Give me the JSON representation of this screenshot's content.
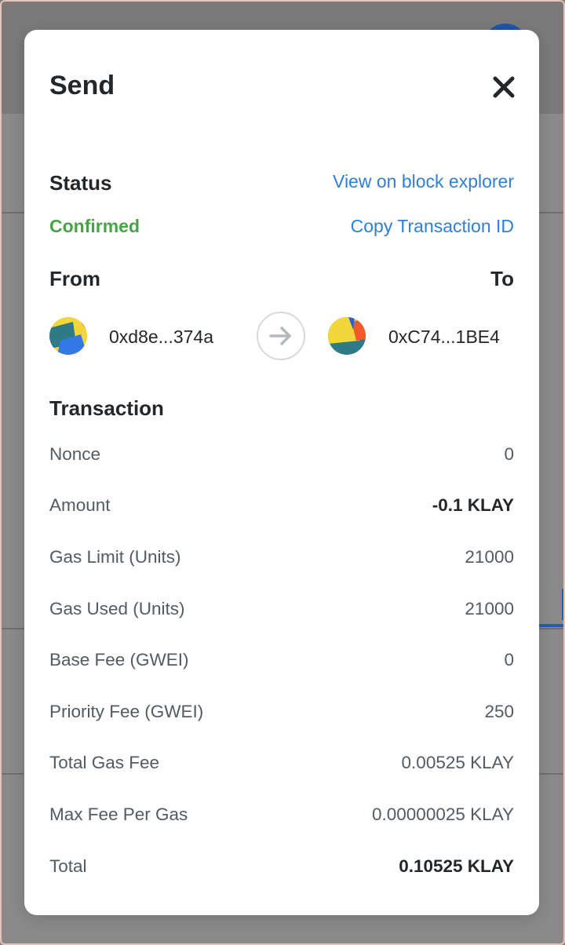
{
  "modal": {
    "title": "Send"
  },
  "status": {
    "label": "Status",
    "value": "Confirmed",
    "value_color": "#46a447",
    "view_explorer_link": "View on block explorer",
    "copy_tx_link": "Copy Transaction ID",
    "link_color": "#2f7fd6"
  },
  "parties": {
    "from_label": "From",
    "to_label": "To",
    "from_address": "0xd8e...374a",
    "to_address": "0xC74...1BE4"
  },
  "transaction": {
    "label": "Transaction",
    "rows": [
      {
        "key": "Nonce",
        "value": "0"
      },
      {
        "key": "Amount",
        "value": "-0.1 KLAY"
      },
      {
        "key": "Gas Limit (Units)",
        "value": "21000"
      },
      {
        "key": "Gas Used (Units)",
        "value": "21000"
      },
      {
        "key": "Base Fee (GWEI)",
        "value": "0"
      },
      {
        "key": "Priority Fee (GWEI)",
        "value": "250"
      },
      {
        "key": "Total Gas Fee",
        "value": "0.00525 KLAY"
      },
      {
        "key": "Max Fee Per Gas",
        "value": "0.00000025 KLAY"
      },
      {
        "key": "Total",
        "value": "0.10525 KLAY"
      }
    ]
  },
  "icons": {
    "close": "close-icon",
    "arrow": "arrow-right-icon",
    "from_avatar": "jazzicon-avatar",
    "to_avatar": "jazzicon-avatar"
  }
}
